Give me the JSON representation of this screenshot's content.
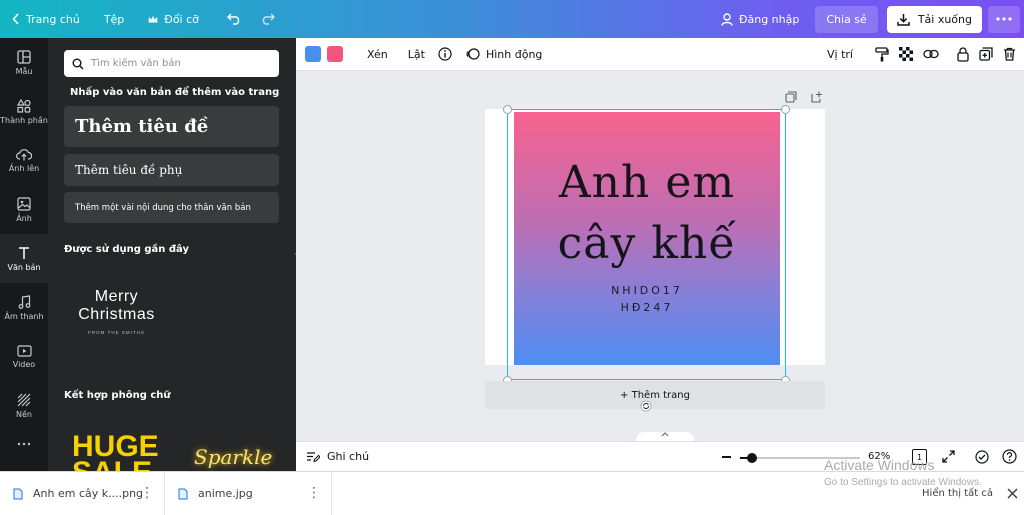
{
  "topbar": {
    "home": "Trang chủ",
    "file": "Tệp",
    "resize": "Đổi cỡ",
    "login": "Đăng nhập",
    "share": "Chia sẻ",
    "download": "Tải xuống"
  },
  "rail": {
    "items": [
      {
        "label": "Mẫu",
        "icon": "layout-icon"
      },
      {
        "label": "Thành phần",
        "icon": "shapes-icon"
      },
      {
        "label": "Ảnh lên",
        "icon": "cloud-upload-icon"
      },
      {
        "label": "Ảnh",
        "icon": "image-icon"
      },
      {
        "label": "Văn bản",
        "icon": "text-icon"
      },
      {
        "label": "Âm thanh",
        "icon": "music-icon"
      },
      {
        "label": "Video",
        "icon": "video-icon"
      },
      {
        "label": "Nền",
        "icon": "background-icon"
      }
    ]
  },
  "panel": {
    "search_placeholder": "Tìm kiếm văn bản",
    "intro": "Nhấp vào văn bản để thêm vào trang",
    "heading_btn": "Thêm tiêu đề",
    "subheading_btn": "Thêm tiêu đề phụ",
    "body_btn": "Thêm một vài nội dung cho thân văn bản",
    "recent_title": "Được sử dụng gần đây",
    "recent_line1": "Merry",
    "recent_line2": "Christmas",
    "recent_line3": "FROM THE SMITHS",
    "combos_title": "Kết hợp phông chữ",
    "combo1": "HUGE SALE",
    "combo2": "Sparkle"
  },
  "toolbar": {
    "color1": "#4a8ef0",
    "color2": "#f2567f",
    "crop": "Xén",
    "flip": "Lật",
    "animate": "Hình động",
    "position": "Vị trí"
  },
  "design": {
    "title_line1": "Anh em",
    "title_line2": "cây khế",
    "sub_line1": "NHIDO17",
    "sub_line2": "HĐ247",
    "add_page": "+ Thêm trang"
  },
  "bottombar": {
    "notes": "Ghi chú",
    "zoom": "62%",
    "zoom_fraction": 0.62,
    "page_number": "1"
  },
  "downloads": {
    "files": [
      "Anh em cây k....png",
      "anime.jpg"
    ],
    "show_all": "Hiển thị tất cả"
  },
  "watermark": {
    "line1": "Activate Windows",
    "line2": "Go to Settings to activate Windows."
  }
}
